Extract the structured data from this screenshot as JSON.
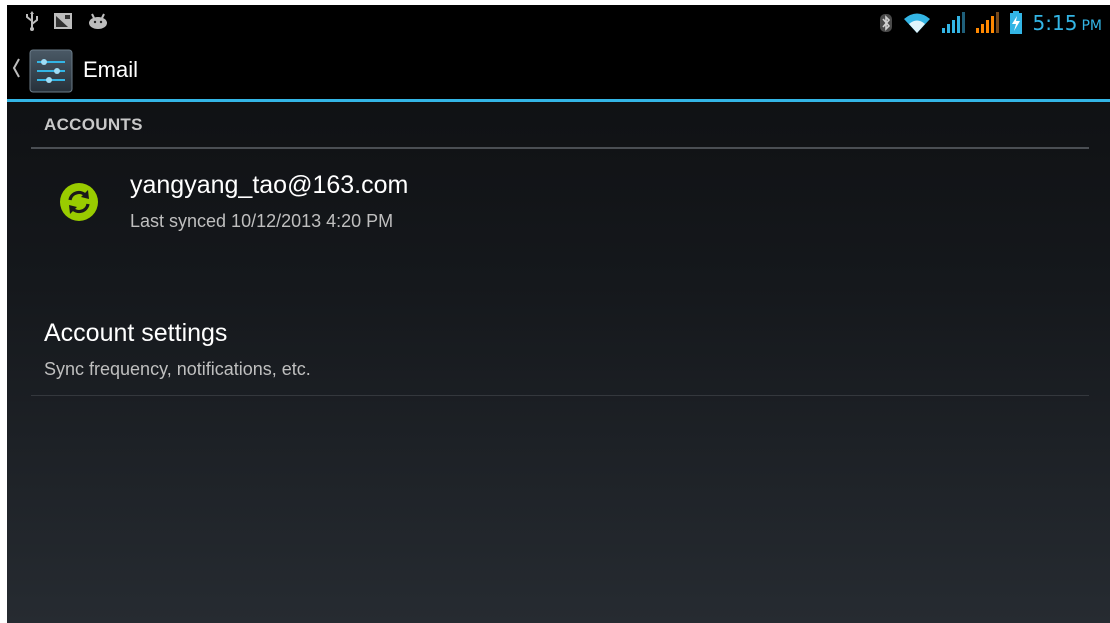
{
  "status_bar": {
    "left_icons": [
      "usb-icon",
      "screenshot-icon",
      "android-debug-icon"
    ],
    "right_icons": [
      "bluetooth-icon",
      "wifi-icon",
      "signal-icon",
      "signal-icon-2",
      "battery-charging-icon"
    ],
    "time": "5:15",
    "ampm": "PM",
    "accent_color": "#33b5e5"
  },
  "action_bar": {
    "title": "Email",
    "icon": "settings-sliders-icon"
  },
  "accounts": {
    "header": "ACCOUNTS",
    "items": [
      {
        "email": "yangyang_tao@163.com",
        "status": "Last synced 10/12/2013 4:20 PM",
        "icon": "sync-icon",
        "icon_color": "#99cc00"
      }
    ]
  },
  "settings": {
    "title": "Account settings",
    "subtitle": "Sync frequency, notifications, etc."
  }
}
